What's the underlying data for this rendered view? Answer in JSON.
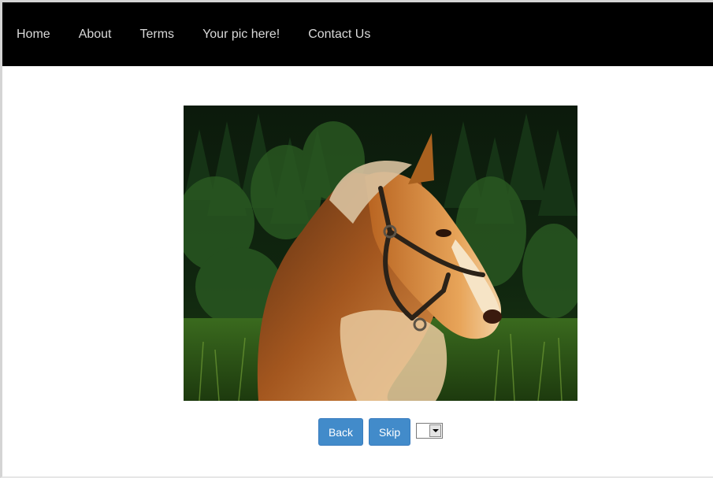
{
  "nav": {
    "items": [
      {
        "label": "Home"
      },
      {
        "label": "About"
      },
      {
        "label": "Terms"
      },
      {
        "label": "Your pic here!"
      },
      {
        "label": "Contact Us"
      }
    ]
  },
  "photo": {
    "subject": "horse-photo"
  },
  "controls": {
    "back_label": "Back",
    "skip_label": "Skip",
    "select_value": ""
  },
  "colors": {
    "navbar_bg": "#000000",
    "nav_text": "#d9d9d9",
    "button_bg": "#428bca"
  }
}
